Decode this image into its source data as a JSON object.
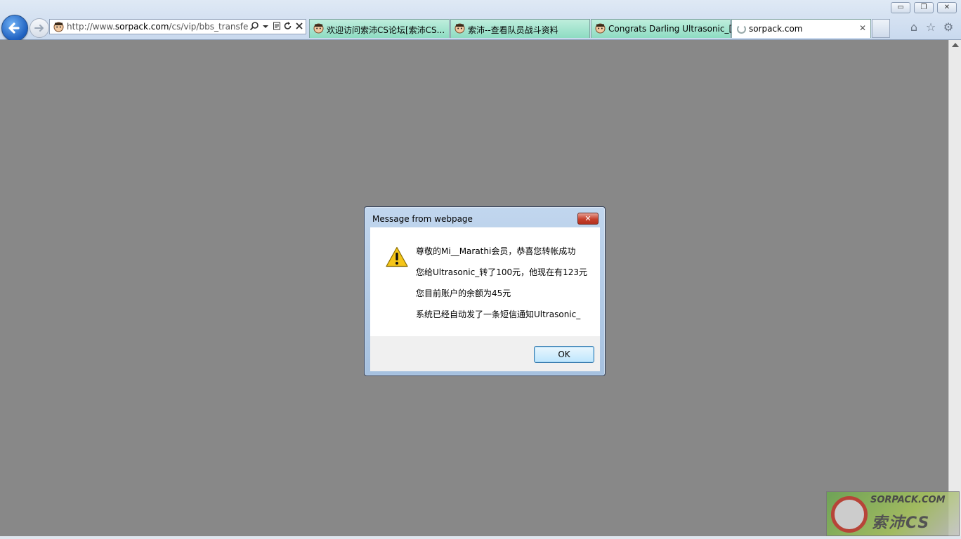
{
  "browser": {
    "address": {
      "url_prefix": "http://www.",
      "url_domain": "sorpack.com",
      "url_path": "/cs/vip/bbs_transfer.as"
    },
    "tabs": [
      {
        "label": "欢迎访问索沛CS论坛[索沛CS..."
      },
      {
        "label": "索沛--查看队员战斗资料"
      },
      {
        "label": "Congrats Darling Ultrasonic_[..."
      },
      {
        "label": "sorpack.com",
        "close": "✕"
      }
    ],
    "caption": {
      "minimize": "▭",
      "restore": "❐",
      "close": "✕"
    },
    "tools": {
      "home": "⌂",
      "favorites": "☆",
      "settings": "⚙"
    }
  },
  "dialog": {
    "title": "Message from webpage",
    "close": "✕",
    "lines": [
      "尊敬的Mi__Marathi会员，恭喜您转帐成功",
      "您给Ultrasonic_转了100元，他现在有123元",
      "您目前账户的余额为45元",
      "系统已经自动发了一条短信通知Ultrasonic_"
    ],
    "ok_label": "OK"
  },
  "watermark": {
    "line1": "SORPACK.COM",
    "line2": "索沛CS"
  },
  "colors": {
    "page_bg": "#888888",
    "tab_bg": "#8ddcc2",
    "dialog_frame": "#a6c1e0",
    "ok_button": "#bee6fd"
  }
}
